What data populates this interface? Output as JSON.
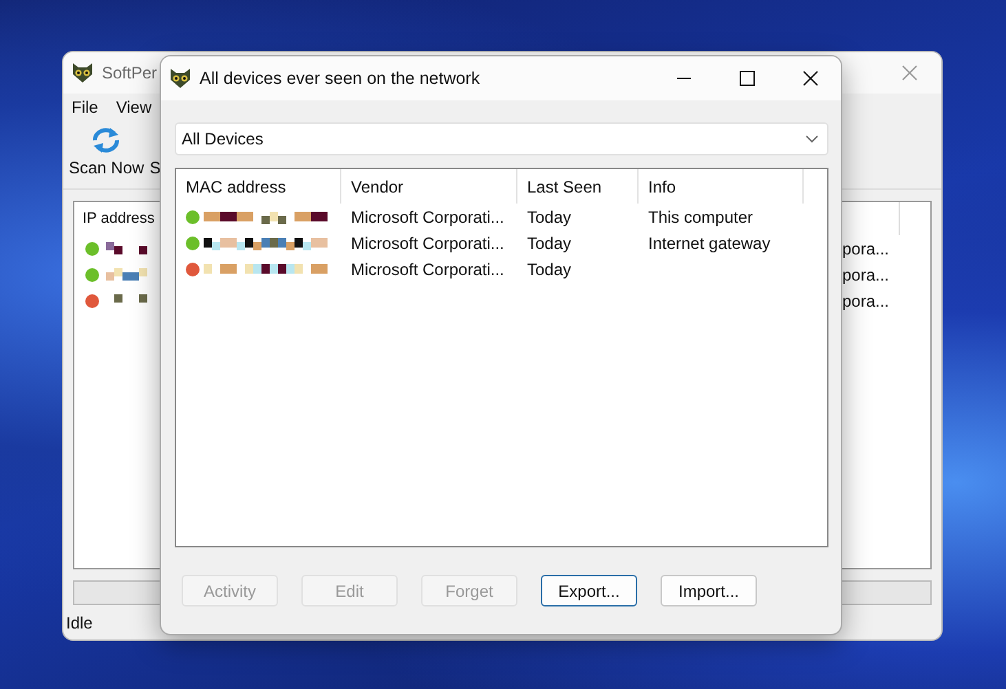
{
  "background_window": {
    "title": "SoftPer",
    "menu": [
      "File",
      "View"
    ],
    "toolbar": [
      {
        "label": "Scan Now",
        "kind": "scan"
      },
      {
        "label": "S",
        "kind": "plain"
      }
    ],
    "table": {
      "columns": [
        "IP address"
      ],
      "rows": [
        {
          "color": "#6cbf2a",
          "column_2": "pora..."
        },
        {
          "color": "#6cbf2a",
          "column_2": "pora..."
        },
        {
          "color": "#e0583c",
          "column_2": "pora..."
        }
      ]
    },
    "progress": {
      "level": 0
    },
    "status_bar": "Idle"
  },
  "dialog": {
    "title": "All devices ever seen on the network",
    "filter": "All Devices",
    "table": {
      "columns": [
        "MAC address",
        "Vendor",
        "Last Seen",
        "Info"
      ],
      "rows": [
        {
          "color": "#6cbf2a",
          "vendor": "Microsoft Corporati...",
          "last_seen": "Today",
          "info": "This computer"
        },
        {
          "color": "#6cbf2a",
          "vendor": "Microsoft Corporati...",
          "last_seen": "Today",
          "info": "Internet gateway"
        },
        {
          "color": "#e0583c",
          "vendor": "Microsoft Corporati...",
          "last_seen": "Today"
        }
      ]
    },
    "buttons": [
      {
        "label": "Activity",
        "disabled": true,
        "default": false
      },
      {
        "label": "Edit",
        "disabled": true,
        "default": false
      },
      {
        "label": "Forget",
        "disabled": true,
        "default": false
      },
      {
        "label": "Export...",
        "disabled": false,
        "default": true
      },
      {
        "label": "Import...",
        "disabled": false,
        "default": false
      }
    ]
  }
}
